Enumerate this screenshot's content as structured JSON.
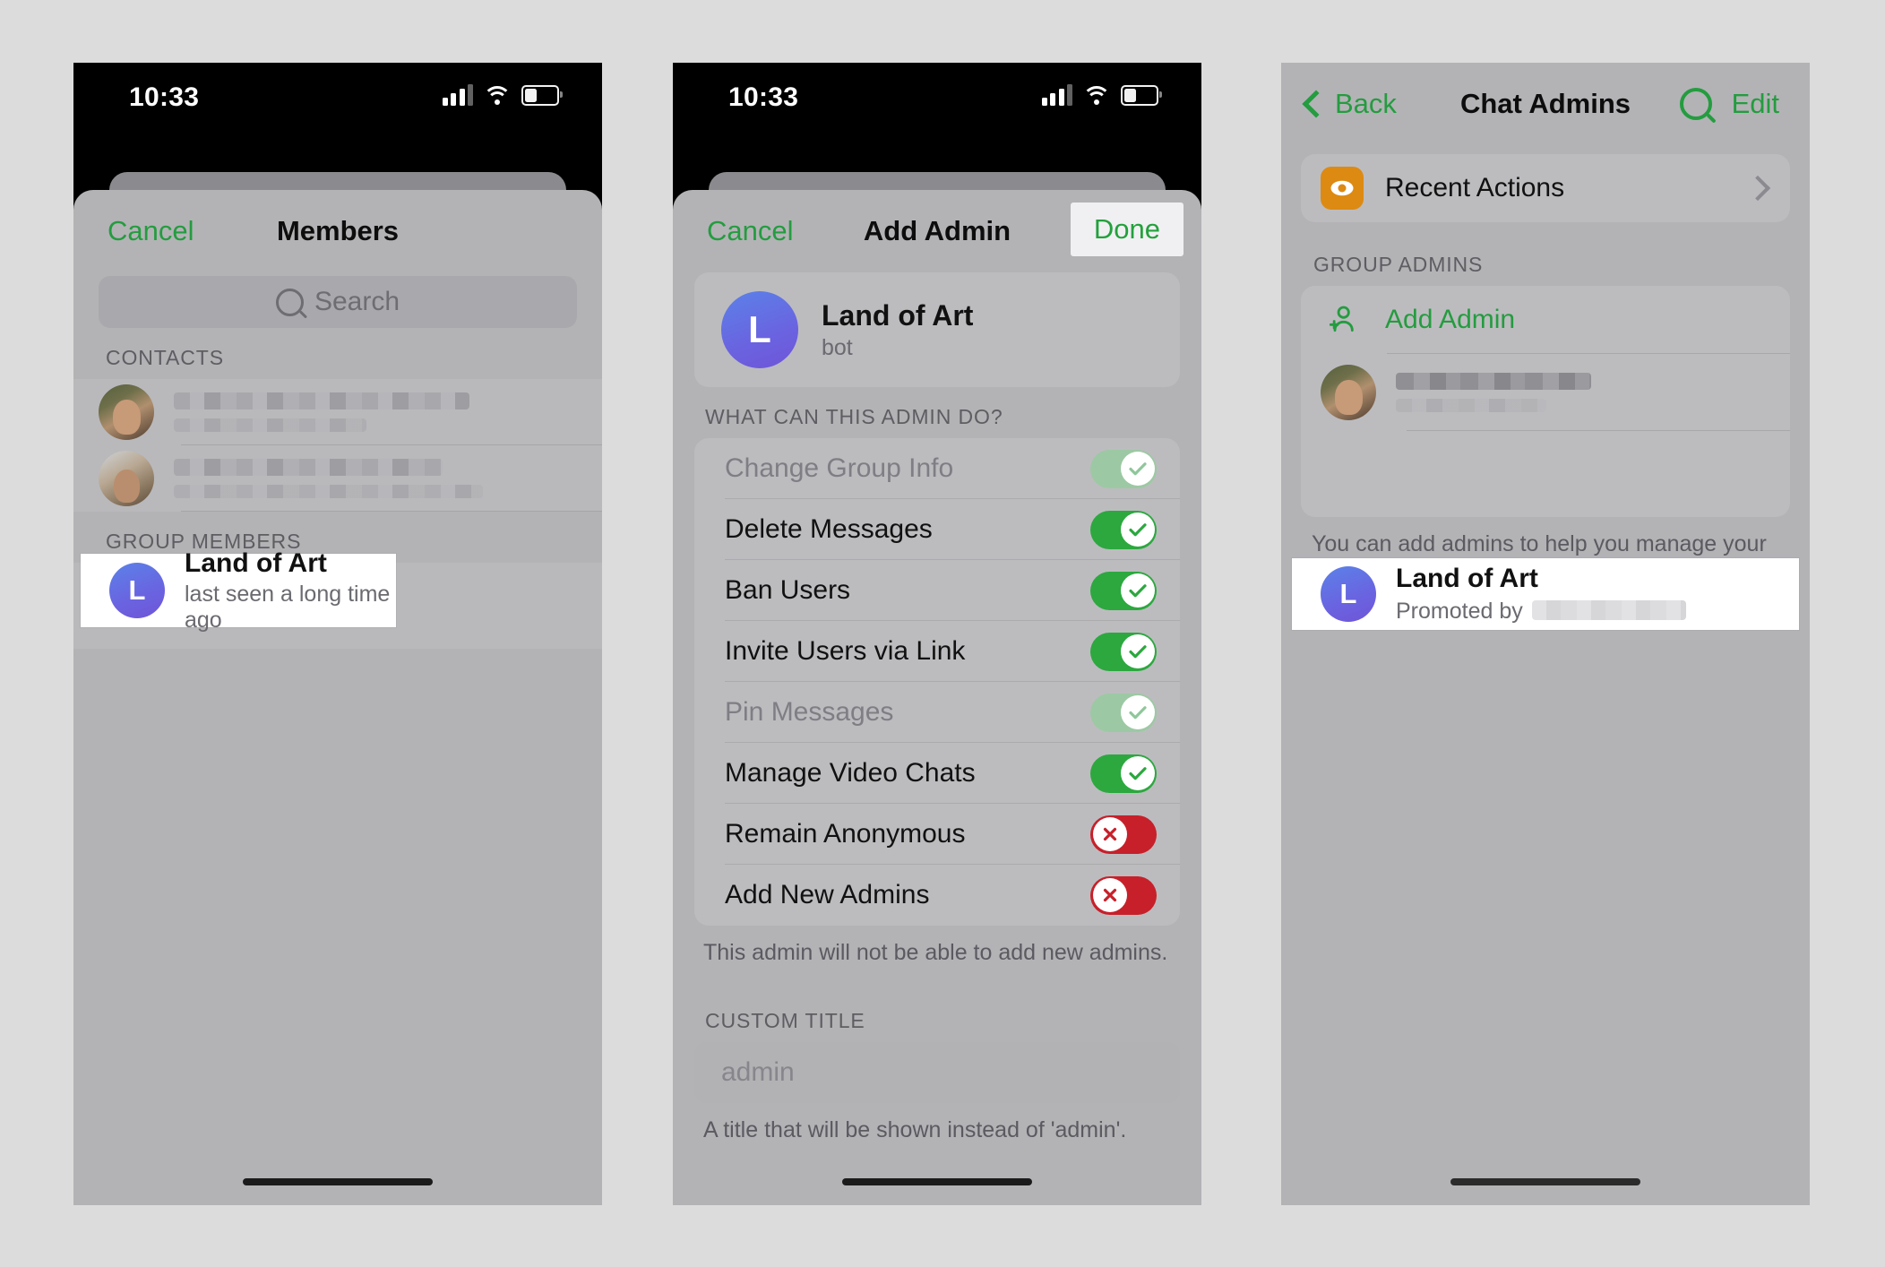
{
  "status_bar": {
    "time": "10:33"
  },
  "phone1": {
    "nav": {
      "cancel": "Cancel",
      "title": "Members"
    },
    "search": {
      "placeholder": "Search",
      "icon": "search-icon"
    },
    "sections": [
      {
        "label": "CONTACTS",
        "rows": [
          {
            "type": "blurred",
            "avatar": "contact-photo-1"
          },
          {
            "type": "blurred",
            "avatar": "contact-photo-2"
          }
        ]
      },
      {
        "label": "GROUP MEMBERS",
        "rows": [
          {
            "type": "member",
            "avatar_letter": "L",
            "name": "Land of Art",
            "sub": "last seen a long time ago",
            "highlighted": true
          }
        ]
      }
    ]
  },
  "phone2": {
    "nav": {
      "cancel": "Cancel",
      "title": "Add Admin",
      "done": "Done"
    },
    "bot": {
      "avatar_letter": "L",
      "name": "Land of Art",
      "sub": "bot"
    },
    "permissions_header": "WHAT CAN THIS ADMIN DO?",
    "permissions": [
      {
        "label": "Change Group Info",
        "state": "on",
        "disabled": true
      },
      {
        "label": "Delete Messages",
        "state": "on",
        "disabled": false
      },
      {
        "label": "Ban Users",
        "state": "on",
        "disabled": false
      },
      {
        "label": "Invite Users via Link",
        "state": "on",
        "disabled": false
      },
      {
        "label": "Pin Messages",
        "state": "on",
        "disabled": true
      },
      {
        "label": "Manage Video Chats",
        "state": "on",
        "disabled": false
      },
      {
        "label": "Remain Anonymous",
        "state": "off",
        "disabled": false
      },
      {
        "label": "Add New Admins",
        "state": "off",
        "disabled": false
      }
    ],
    "permissions_footnote": "This admin will not be able to add new admins.",
    "custom_title": {
      "header": "CUSTOM TITLE",
      "value": "",
      "placeholder": "admin",
      "footnote": "A title that will be shown instead of 'admin'."
    }
  },
  "phone3": {
    "nav": {
      "back": "Back",
      "title": "Chat Admins",
      "search_icon": "search-icon",
      "edit": "Edit"
    },
    "recent_actions": {
      "label": "Recent Actions",
      "icon": "eye-icon",
      "chevron": "chevron-right-icon"
    },
    "section_label": "GROUP ADMINS",
    "add_admin": {
      "label": "Add Admin",
      "icon": "person-add-icon"
    },
    "admins": [
      {
        "type": "blurred",
        "avatar": "contact-photo-1"
      },
      {
        "type": "admin",
        "avatar_letter": "L",
        "name": "Land of Art",
        "sub_prefix": "Promoted by",
        "sub_blurred": true,
        "highlighted": true
      }
    ],
    "footnote": "You can add admins to help you manage your group."
  },
  "colors": {
    "accent_green": "#249c3f",
    "toggle_on": "#2ca83f",
    "toggle_off_red": "#c7202a",
    "recent_actions_orange": "#dd8a12",
    "bot_avatar": "#6a63e0",
    "page_background": "#dcdcdc"
  }
}
